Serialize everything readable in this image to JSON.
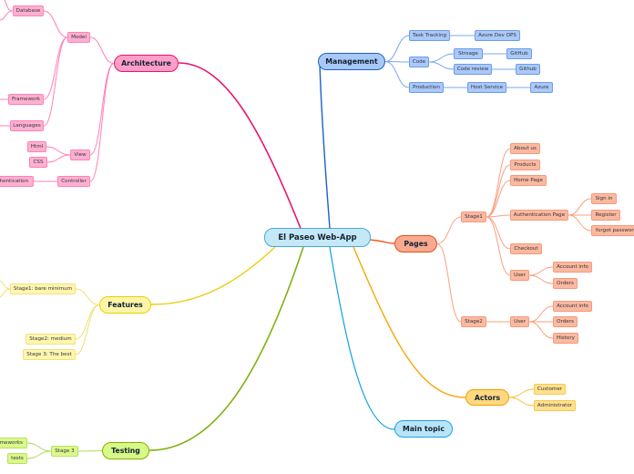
{
  "central": {
    "label": "El Paseo Web-App"
  },
  "architecture": {
    "label": "Architecture",
    "model": {
      "label": "Model",
      "database": "Database",
      "framework": "Framework",
      "languages": "Languages"
    },
    "view": {
      "label": "View",
      "html": "Html",
      "css": "CSS"
    },
    "controller": {
      "label": "Controller",
      "authentication": "Authentication"
    }
  },
  "management": {
    "label": "Management",
    "task_tracking": {
      "label": "Task Tracking",
      "tool": "Azure Dev OPS"
    },
    "code": {
      "label": "Code",
      "storage": {
        "label": "Stroage",
        "tool": "GitHub"
      },
      "code_review": {
        "label": "Code review",
        "tool": "Github"
      }
    },
    "production": {
      "label": "Production",
      "host": {
        "label": "Host Service",
        "provider": "Azure"
      }
    }
  },
  "pages": {
    "label": "Pages",
    "stage1": {
      "label": "Stage1",
      "about": "About us",
      "products": "Products",
      "home": "Home Page",
      "auth": {
        "label": "Authentication Page",
        "sign_in": "Sign in",
        "register": "Register",
        "forgot": "forgot password"
      },
      "checkout": "Checkout",
      "user": {
        "label": "User",
        "account": "Account info",
        "orders": "Orders"
      }
    },
    "stage2": {
      "label": "Stage2",
      "user": {
        "label": "User",
        "account": "Account info",
        "orders": "Orders",
        "history": "History"
      }
    }
  },
  "actors": {
    "label": "Actors",
    "customer": "Customer",
    "administrator": "Administrator"
  },
  "main_topic": {
    "label": "Main topic"
  },
  "features": {
    "label": "Features",
    "stage1": "Stage1: bare minimum",
    "stage2": "Stage2: medium",
    "stage3": "Stage 3: The best"
  },
  "testing": {
    "label": "Testing",
    "stage3": {
      "label": "Stage 3",
      "frameworks": "Frameworks",
      "tests": "tests"
    }
  },
  "colors": {
    "architecture": "#e8156f",
    "management": "#1a5fd0",
    "pages": "#f05a20",
    "actors": "#f5a800",
    "main_topic": "#10a0e0",
    "features": "#e8d010",
    "testing": "#80b010"
  }
}
